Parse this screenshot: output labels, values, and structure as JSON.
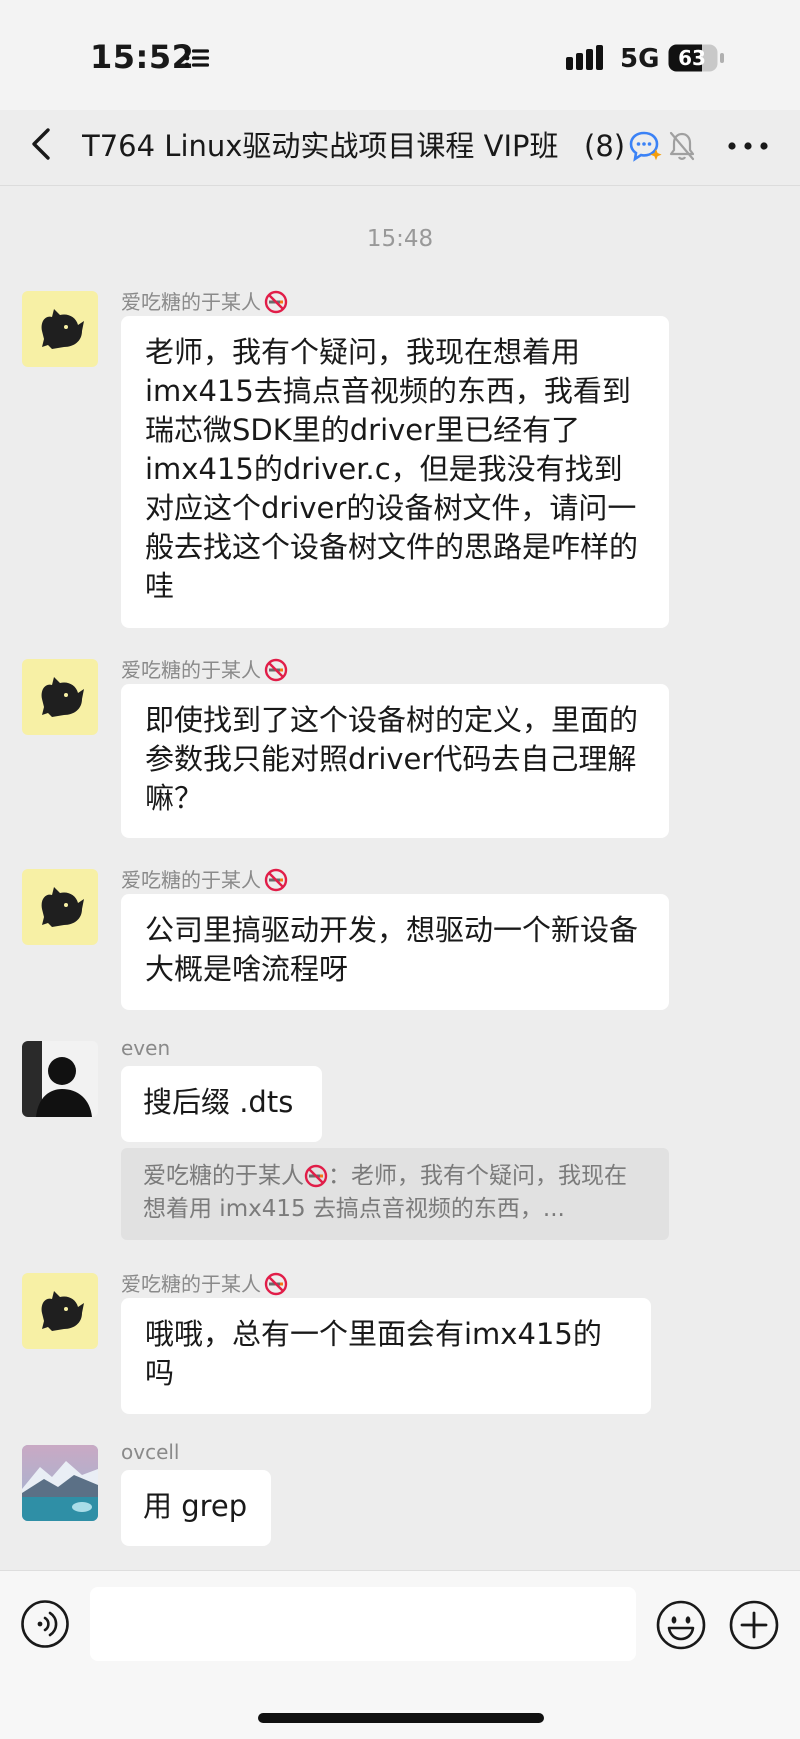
{
  "status_bar": {
    "time": "15:52",
    "network": "5G",
    "battery": "63"
  },
  "header": {
    "title": "T764 Linux驱动实战项目课程 VIP班",
    "member_count": "(8)"
  },
  "timestamp": "15:48",
  "messages": [
    {
      "sender": "爱吃糖的于某人",
      "text": "老师，我有个疑问，我现在想着用imx415去搞点音视频的东西，我看到瑞芯微SDK里的driver里已经有了imx415的driver.c，但是我没有找到对应这个driver的设备树文件，请问一般去找这个设备树文件的思路是咋样的哇"
    },
    {
      "sender": "爱吃糖的于某人",
      "text": "即使找到了这个设备树的定义，里面的参数我只能对照driver代码去自己理解嘛？"
    },
    {
      "sender": "爱吃糖的于某人",
      "text": "公司里搞驱动开发，想驱动一个新设备大概是啥流程呀"
    },
    {
      "sender": "even",
      "text": "搜后缀 .dts",
      "quote": {
        "name": "爱吃糖的于某人",
        "text": "：老师，我有个疑问，我现在想着用 imx415 去搞点音视频的东西，..."
      }
    },
    {
      "sender": "爱吃糖的于某人",
      "text": "哦哦，总有一个里面会有imx415的吗"
    },
    {
      "sender": "ovcell",
      "text": "用 grep"
    }
  ],
  "input": {
    "value": ""
  }
}
